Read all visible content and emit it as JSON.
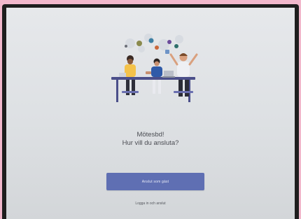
{
  "meeting": {
    "title": "Mötesbd!",
    "question": "Hur vill du ansluta?"
  },
  "actions": {
    "join_as_guest": "Anslut som gäst",
    "sign_in_and_join": "Logga in och anslut"
  },
  "colors": {
    "primary_button": "#5f6fb3",
    "screen_background": "#e2e5e8",
    "case_background": "#f2b8cc"
  },
  "illustration": {
    "icon": "people-at-meeting-table-illustration"
  }
}
